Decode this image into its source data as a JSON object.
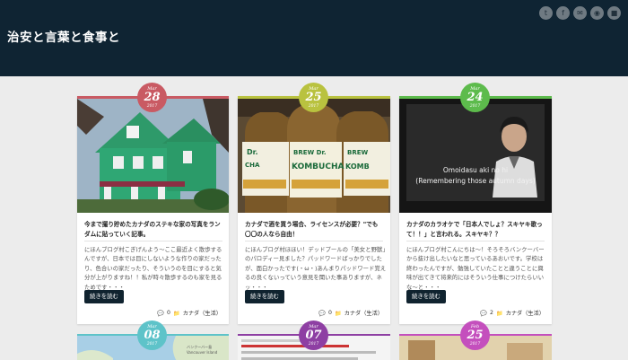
{
  "site": {
    "title": "治安と言葉と食事と"
  },
  "socials": [
    "twitter-icon",
    "facebook-icon",
    "mail-icon",
    "rss-icon",
    "lock-icon"
  ],
  "more_label": "続きを読む",
  "posts": [
    {
      "accent": "#c95a63",
      "date": {
        "month": "Mar",
        "day": "28",
        "year": "2017"
      },
      "title": "今まで撮り貯めたカナダのステキな家の写真をランダムに貼っていく記事。",
      "excerpt": "にほんブログ村こぎげんよう〜ここ最近よく散歩するんですが、日本では目にしないような作りの家だったり、色合いの家だったり、そういうのを目にすると気分が上がりますね！！私が時々散歩するのも家を見るためです・・・",
      "comments": "0",
      "category": "カナダ（生活）"
    },
    {
      "accent": "#b9c23f",
      "date": {
        "month": "Mar",
        "day": "25",
        "year": "2017"
      },
      "title": "カナダで酒を買う場合、ライセンスが必要？\"でも〇〇の人なら自由！",
      "excerpt": "にほんブログ村ほほい！デッドプールの「美女と野獣」のパロディー見ました？パッドワードばっかりでしたが、面白かったです(・ω・)あんまりパッドワード覚えるの良くないっていう意見を聞いた事ありますが、ネッ・・・",
      "comments": "0",
      "category": "カナダ（生活）"
    },
    {
      "accent": "#5dbb4c",
      "date": {
        "month": "Mar",
        "day": "24",
        "year": "2017"
      },
      "title": "カナダのカラオケで「日本人でしょ？スキヤキ歌って！！」と言われる。スキヤキ？？",
      "excerpt": "にほんブログ村こんにちは〜！そろそろバンクーバーから抜け出したいなと思っているあおいです。学校は終わったんですが、勉強していたことと違うことに興味が出てきて将来的にはそういう仕事につけたらいいな〜と・・・",
      "comments": "2",
      "category": "カナダ（生活）",
      "subtitle_line1": "Omoidasu aki no hi",
      "subtitle_line2": "(Remembering those autumn days)"
    }
  ],
  "bottom_posts": [
    {
      "accent": "#5ec3c9",
      "date": {
        "month": "Mar",
        "day": "08",
        "year": "2017"
      },
      "map_label": "バンクーバー島\nVancouver Island"
    },
    {
      "accent": "#8e3fa3",
      "date": {
        "month": "Mar",
        "day": "07",
        "year": "2017"
      }
    },
    {
      "accent": "#c44fbd",
      "date": {
        "month": "Feb",
        "day": "25",
        "year": "2017"
      }
    }
  ]
}
